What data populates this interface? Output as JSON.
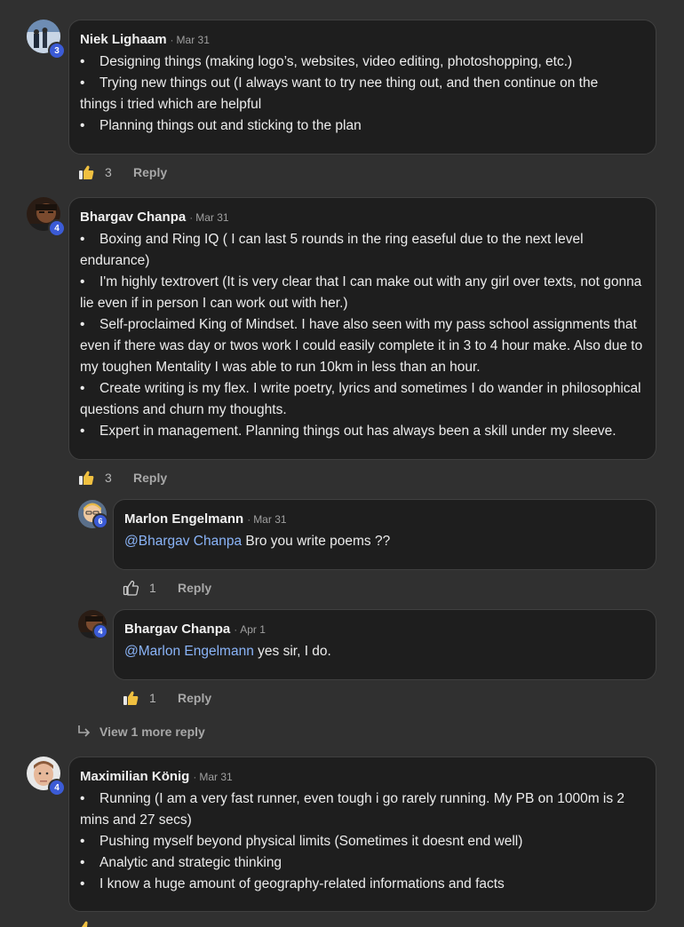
{
  "comments": [
    {
      "author": "Niek Lighaam",
      "date": "Mar 31",
      "level": "3",
      "lines": [
        "Designing things (making logo’s, websites, video editing, photoshopping, etc.)",
        "Trying new things out (I always want to try nee thing out, and then continue on the",
        "Planning things out and sticking to the plan"
      ],
      "continuation": "things i tried which are helpful",
      "likes": "3",
      "reply_label": "Reply"
    },
    {
      "author": "Bhargav Chanpa",
      "date": "Mar 31",
      "level": "4",
      "items": [
        "Boxing and Ring IQ ( I can last 5 rounds in the ring easeful due to the next level endurance)",
        "I'm highly textrovert (It is very clear that I can make out with any girl over texts, not gonna lie even if in person I can work out with her.)",
        "Self-proclaimed King of Mindset. I have also seen with my pass school assignments that even if there was day or twos work I could easily complete it in 3 to 4 hour make. Also due to my toughen Mentality I was able to run 10km in less than an hour.",
        "Create writing is my flex. I write poetry, lyrics and sometimes I do wander in philosophical questions and churn my thoughts.",
        "Expert in management. Planning things out has always been a skill under my sleeve."
      ],
      "likes": "3",
      "reply_label": "Reply"
    }
  ],
  "replies": [
    {
      "author": "Marlon Engelmann",
      "date": "Mar 31",
      "level": "6",
      "mention": "@Bhargav Chanpa",
      "text": " Bro you write poems ??",
      "likes": "1",
      "reply_label": "Reply"
    },
    {
      "author": "Bhargav Chanpa",
      "date": "Apr 1",
      "level": "4",
      "mention": "@Marlon Engelmann",
      "text": " yes sir, I do.",
      "likes": "1",
      "reply_label": "Reply"
    }
  ],
  "view_more_replies": "View 1 more reply",
  "last_comment": {
    "author": "Maximilian König",
    "date": "Mar 31",
    "level": "4",
    "items": [
      "Running (I am a very fast runner, even tough i go rarely running. My PB on 1000m is 2 mins and 27 secs)",
      "Pushing myself beyond physical limits (Sometimes it doesnt end well)",
      "Analytic and strategic thinking",
      "I know a huge amount of geography-related informations and facts"
    ]
  },
  "bullet_char": "•",
  "date_separator": "·",
  "colors": {
    "background": "#303030",
    "bubble": "#1e1e1e",
    "mention": "#8ab4f8",
    "badge": "#3b5bd6"
  }
}
